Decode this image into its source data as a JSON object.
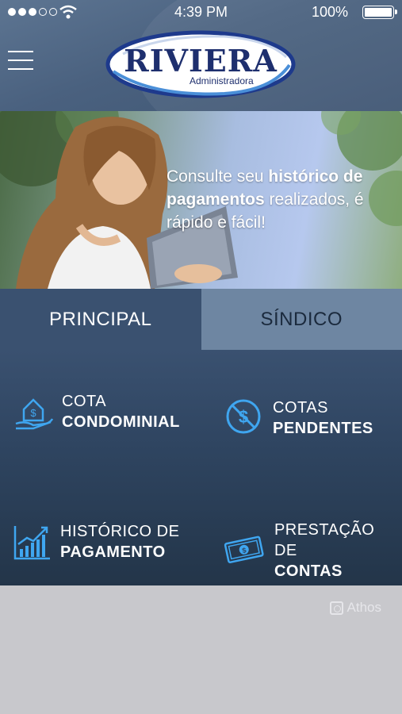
{
  "status_bar": {
    "time": "4:39 PM",
    "battery": "100%"
  },
  "header": {
    "logo_name": "RIVIERA",
    "logo_subtitle": "Administradora"
  },
  "banner": {
    "text_part1": "Consulte seu ",
    "text_bold": "histórico de pagamentos",
    "text_part2": " realizados, é rápido e fácil!"
  },
  "tabs": [
    {
      "label": "PRINCIPAL",
      "active": true
    },
    {
      "label": "SÍNDICO",
      "active": false
    }
  ],
  "menu": [
    {
      "line1": "COTA",
      "line2": "CONDOMINIAL",
      "icon": "house-money-hand-icon"
    },
    {
      "line1": "COTAS",
      "line2": "PENDENTES",
      "icon": "no-money-icon"
    },
    {
      "line1": "HISTÓRICO DE",
      "line2": "PAGAMENTO",
      "icon": "bar-chart-growth-icon"
    },
    {
      "line1": "PRESTAÇÃO DE",
      "line2": "CONTAS",
      "icon": "banknote-icon"
    }
  ],
  "footer": {
    "brand": "Athos"
  },
  "colors": {
    "header": "#4a617f",
    "tab_active": "#3a5170",
    "tab_inactive": "#6e86a2",
    "icon_accent": "#3fa6f0",
    "footer": "#c8c8cc"
  }
}
